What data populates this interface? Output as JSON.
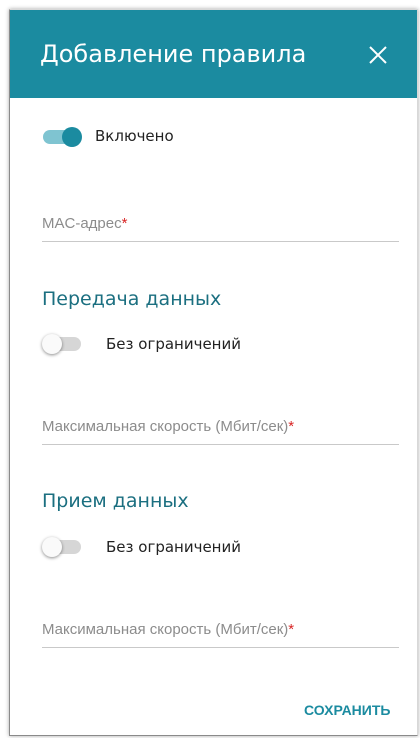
{
  "dialog": {
    "title": "Добавление правила",
    "close_icon": "close-icon",
    "accent_color": "#1b8ba0"
  },
  "enabled_toggle": {
    "label": "Включено",
    "state": "on"
  },
  "mac_field": {
    "label": "MAC-адрес",
    "required_mark": "*",
    "value": ""
  },
  "upload_section": {
    "title": "Передача данных",
    "unlimited_toggle": {
      "label": "Без ограничений",
      "state": "off"
    },
    "max_speed_field": {
      "label": "Максимальная скорость (Мбит/сек)",
      "required_mark": "*",
      "value": ""
    }
  },
  "download_section": {
    "title": "Прием данных",
    "unlimited_toggle": {
      "label": "Без ограничений",
      "state": "off"
    },
    "max_speed_field": {
      "label": "Максимальная скорость (Мбит/сек)",
      "required_mark": "*",
      "value": ""
    }
  },
  "actions": {
    "save_label": "СОХРАНИТЬ"
  }
}
